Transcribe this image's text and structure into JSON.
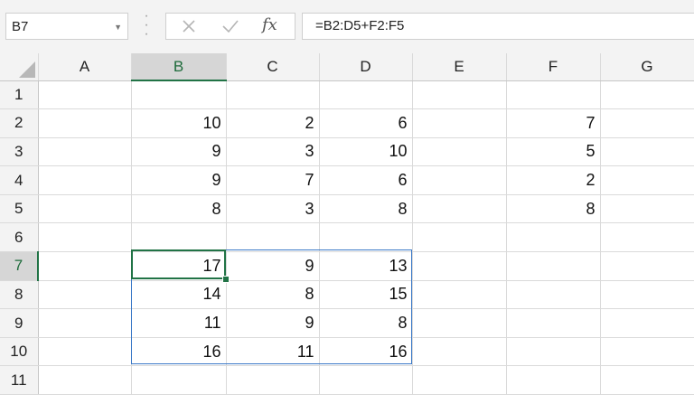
{
  "name_box": {
    "value": "B7"
  },
  "formula": {
    "text": "=B2:D5+F2:F5"
  },
  "icons": {
    "fx": "fx"
  },
  "grid": {
    "columns": [
      "A",
      "B",
      "C",
      "D",
      "E",
      "F",
      "G"
    ],
    "active_cell": "B7",
    "rows": [
      {
        "n": "1",
        "cells": [
          "",
          "",
          "",
          "",
          "",
          "",
          ""
        ]
      },
      {
        "n": "2",
        "cells": [
          "",
          "10",
          "2",
          "6",
          "",
          "7",
          ""
        ]
      },
      {
        "n": "3",
        "cells": [
          "",
          "9",
          "3",
          "10",
          "",
          "5",
          ""
        ]
      },
      {
        "n": "4",
        "cells": [
          "",
          "9",
          "7",
          "6",
          "",
          "2",
          ""
        ]
      },
      {
        "n": "5",
        "cells": [
          "",
          "8",
          "3",
          "8",
          "",
          "8",
          ""
        ]
      },
      {
        "n": "6",
        "cells": [
          "",
          "",
          "",
          "",
          "",
          "",
          ""
        ]
      },
      {
        "n": "7",
        "cells": [
          "",
          "17",
          "9",
          "13",
          "",
          "",
          ""
        ]
      },
      {
        "n": "8",
        "cells": [
          "",
          "14",
          "8",
          "15",
          "",
          "",
          ""
        ]
      },
      {
        "n": "9",
        "cells": [
          "",
          "11",
          "9",
          "8",
          "",
          "",
          ""
        ]
      },
      {
        "n": "10",
        "cells": [
          "",
          "16",
          "11",
          "16",
          "",
          "",
          ""
        ]
      },
      {
        "n": "11",
        "cells": [
          "",
          "",
          "",
          "",
          "",
          "",
          ""
        ]
      }
    ]
  }
}
